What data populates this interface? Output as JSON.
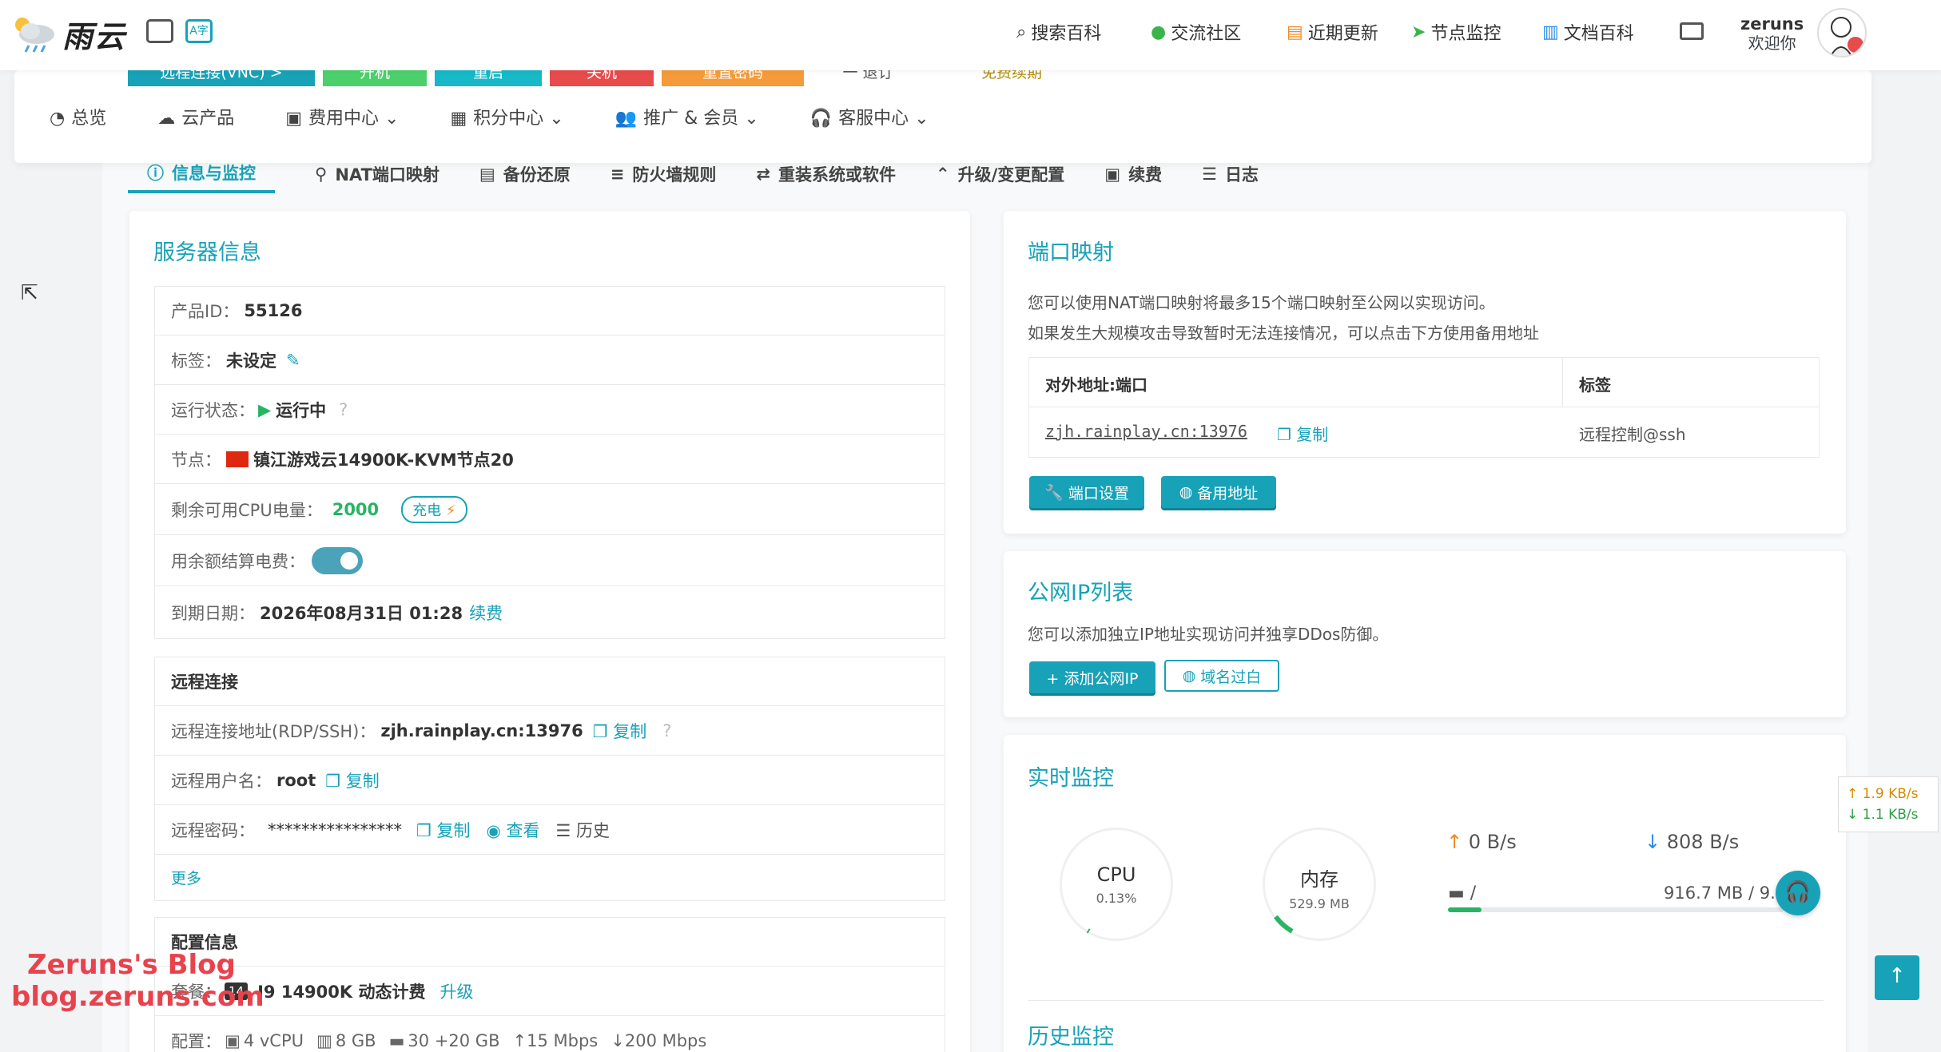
{
  "header": {
    "brand": "雨云",
    "nav": [
      {
        "icon": "search-icon",
        "label": "搜索百科"
      },
      {
        "icon": "wechat-icon",
        "label": "交流社区"
      },
      {
        "icon": "news-icon",
        "label": "近期更新"
      },
      {
        "icon": "send-icon",
        "label": "节点监控"
      },
      {
        "icon": "book-icon",
        "label": "文档百科"
      }
    ],
    "user": {
      "name": "zeruns",
      "greeting": "欢迎你"
    }
  },
  "actions": [
    {
      "label": "远程连接(VNC)  >",
      "color": "#17a2b8"
    },
    {
      "label": "开机",
      "color": "#4cd06c"
    },
    {
      "label": "重启",
      "color": "#17b8c8"
    },
    {
      "label": "关机",
      "color": "#e84b4b"
    },
    {
      "label": "重置密码",
      "color": "#f59b3a"
    }
  ],
  "actions_extra": [
    "一 退订",
    "免费续期"
  ],
  "menu": [
    {
      "icon": "dashboard-icon",
      "label": "总览",
      "dropdown": false
    },
    {
      "icon": "cloud-icon",
      "label": "云产品",
      "dropdown": false
    },
    {
      "icon": "money-icon",
      "label": "费用中心",
      "dropdown": true
    },
    {
      "icon": "gift-icon",
      "label": "积分中心",
      "dropdown": true
    },
    {
      "icon": "users-icon",
      "label": "推广 & 会员",
      "dropdown": true
    },
    {
      "icon": "headset-icon",
      "label": "客服中心",
      "dropdown": true
    }
  ],
  "tabs": [
    {
      "label": "信息与监控",
      "active": true
    },
    {
      "label": "NAT端口映射"
    },
    {
      "label": "备份还原"
    },
    {
      "label": "防火墙规则"
    },
    {
      "label": "重装系统或软件"
    },
    {
      "label": "升级/变更配置"
    },
    {
      "label": "续费"
    },
    {
      "label": "日志"
    }
  ],
  "server": {
    "title": "服务器信息",
    "product_id_label": "产品ID：",
    "product_id": "55126",
    "tag_label": "标签：",
    "tag": "未设定",
    "status_label": "运行状态：",
    "status": "运行中",
    "node_label": "节点：",
    "node": "镇江游戏云14900K-KVM节点20",
    "cpu_label": "剩余可用CPU电量：",
    "cpu_value": "2000",
    "charge": "充电",
    "balance_label": "用余额结算电费：",
    "balance_toggle": true,
    "expire_label": "到期日期：",
    "expire": "2026年08月31日 01:28",
    "renew": "续费"
  },
  "remote": {
    "title": "远程连接",
    "addr_label": "远程连接地址(RDP/SSH)：",
    "addr": "zjh.rainplay.cn:13976",
    "copy": "复制",
    "user_label": "远程用户名：",
    "user": "root",
    "pwd_label": "远程密码：",
    "pwd": "****************",
    "view": "查看",
    "history": "历史",
    "more": "更多"
  },
  "config": {
    "title": "配置信息",
    "plan_label": "套餐：",
    "plan_badge": "14",
    "plan": "I9 14900K 动态计费",
    "upgrade": "升级",
    "spec_label": "配置：",
    "cpu": "4 vCPU",
    "ram": "8 GB",
    "disk": "30 +20 GB",
    "up": "15 Mbps",
    "down": "200 Mbps"
  },
  "ports": {
    "title": "端口映射",
    "desc1": "您可以使用NAT端口映射将最多15个端口映射至公网以实现访问。",
    "desc2": "如果发生大规模攻击导致暂时无法连接情况，可以点击下方使用备用地址",
    "col1": "对外地址:端口",
    "col2": "标签",
    "addr": "zjh.rainplay.cn:13976",
    "copy": "复制",
    "tag": "远程控制@ssh",
    "btn_settings": "端口设置",
    "btn_backup": "备用地址"
  },
  "ips": {
    "title": "公网IP列表",
    "desc": "您可以添加独立IP地址实现访问并独享DDos防御。",
    "btn_add": "+ 添加公网IP",
    "btn_whitelist": "域名过白"
  },
  "monitor": {
    "title": "实时监控",
    "cpu_label": "CPU",
    "cpu_pct": "0.13%",
    "cpu_fraction": 0.0013,
    "mem_label": "内存",
    "mem_val": "529.9 MB",
    "mem_fraction": 0.065,
    "up": "0 B/s",
    "down": "808 B/s",
    "disk_mount": "/",
    "disk_usage": "916.7 MB / 9.",
    "disk_fraction": 0.1
  },
  "history": {
    "title": "历史监控"
  },
  "netspeed": {
    "up": "1.9 KB/s",
    "down": "1.1 KB/s"
  },
  "watermark": {
    "line1": "Zeruns's Blog",
    "line2": "blog.zeruns.com"
  }
}
